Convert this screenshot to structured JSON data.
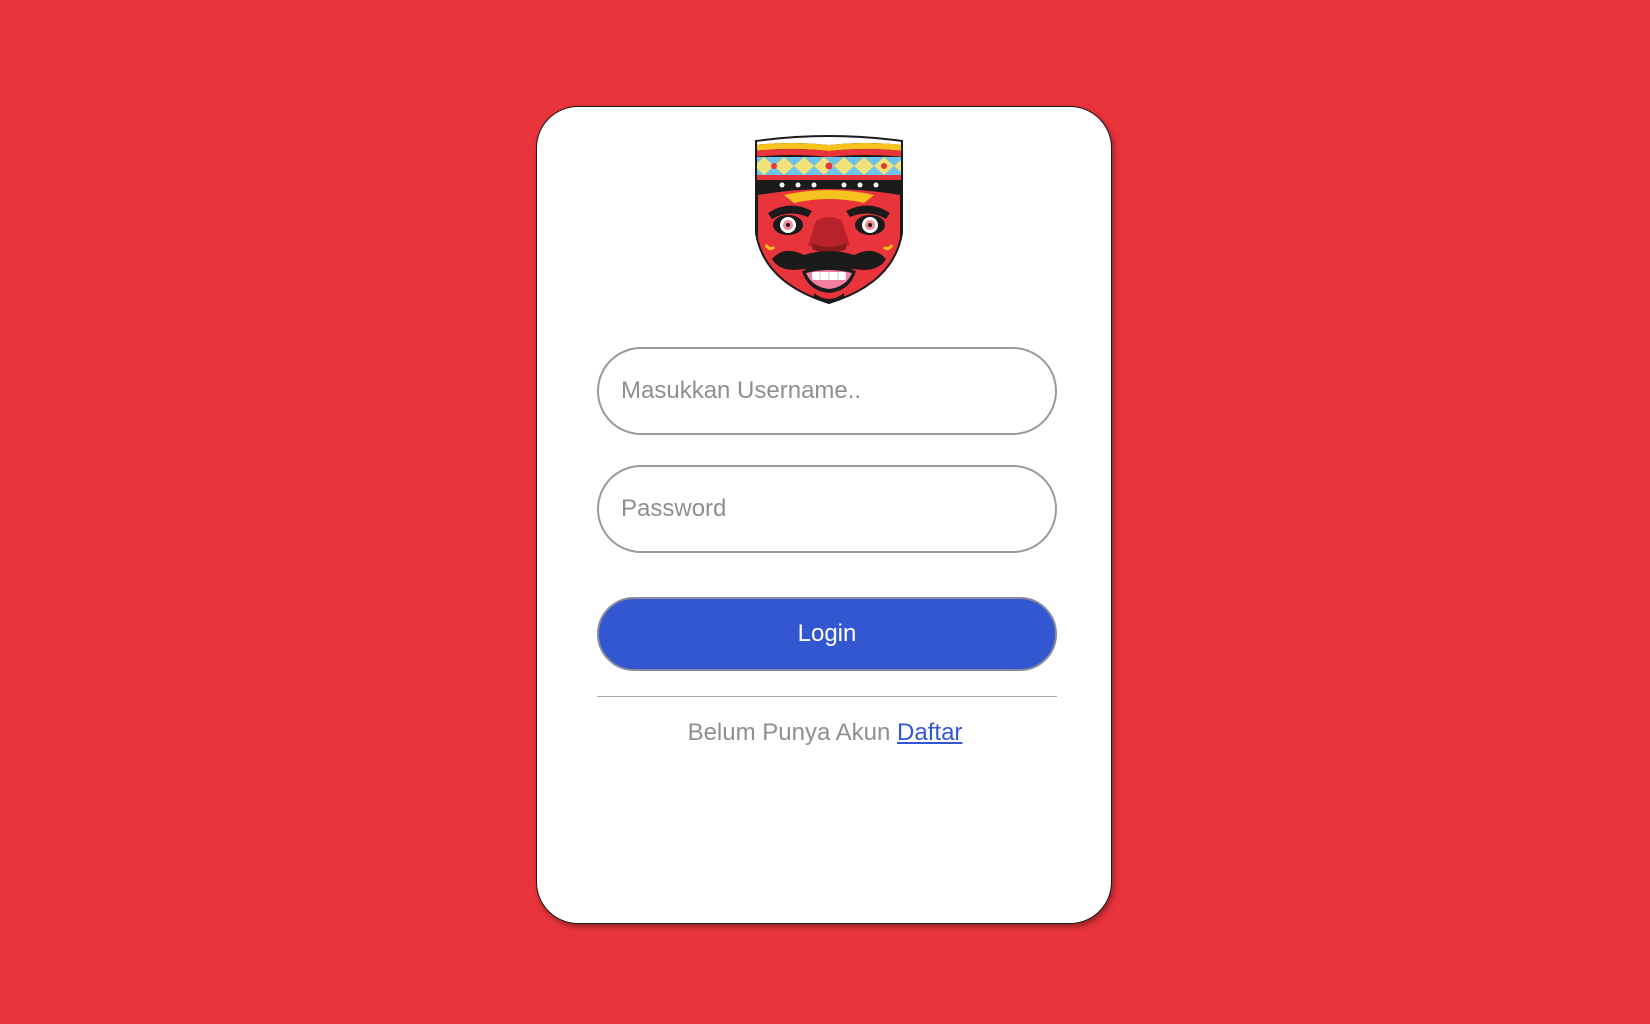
{
  "login_form": {
    "logo_icon": "wayang-mask-icon",
    "username_placeholder": "Masukkan Username..",
    "password_placeholder": "Password",
    "login_label": "Login",
    "signup_prompt": "Belum Punya Akun",
    "signup_link": "Daftar"
  },
  "colors": {
    "background": "#e8343a",
    "card": "#ffffff",
    "button": "#3357d1",
    "link": "#3357d1"
  }
}
